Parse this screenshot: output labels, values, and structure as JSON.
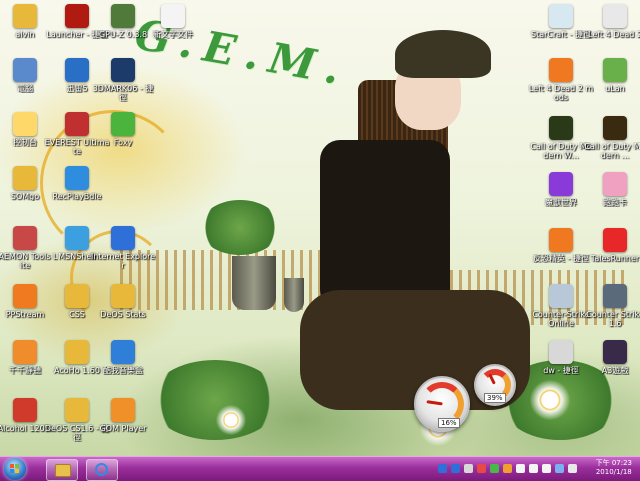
{
  "wallpaper": {
    "title_text": "G.E.M."
  },
  "desktop_icons_left": [
    {
      "name": "alvin",
      "icon": "folder-icon",
      "color": "#e8b83a"
    },
    {
      "name": "Launcher - 捷徑",
      "icon": "launcher-icon",
      "color": "#b01a10"
    },
    {
      "name": "GPU-Z 0.3.8",
      "icon": "gpuz-icon",
      "color": "#4f7a3a"
    },
    {
      "name": "新文字文件",
      "icon": "text-file-icon",
      "color": "#f4f4f4"
    },
    {
      "name": "電腦",
      "icon": "computer-icon",
      "color": "#5a8acb"
    },
    {
      "name": "迅雷5",
      "icon": "thunder-icon",
      "color": "#2a6fc6"
    },
    {
      "name": "3DMARK06 - 捷徑",
      "icon": "3dmark-icon",
      "color": "#1c3a6a"
    },
    {
      "name": "控制台",
      "icon": "control-panel-icon",
      "color": "#ffd86a"
    },
    {
      "name": "EVEREST Ultimate",
      "icon": "everest-icon",
      "color": "#c03030"
    },
    {
      "name": "Foxy",
      "icon": "foxy-icon",
      "color": "#4bb43c"
    },
    {
      "name": "SOMgo",
      "icon": "folder-icon",
      "color": "#e8b83a"
    },
    {
      "name": "RecPlayBdle",
      "icon": "recplay-icon",
      "color": "#2f8de0"
    },
    {
      "name": "DAEMON Tools Lite",
      "icon": "daemon-tools-icon",
      "color": "#c84848"
    },
    {
      "name": "MSNShell",
      "icon": "msnshell-icon",
      "color": "#3ca0e0"
    },
    {
      "name": "Internet Explorer",
      "icon": "ie-icon",
      "color": "#2f6fd8"
    },
    {
      "name": "PPStream",
      "icon": "ppstream-icon",
      "color": "#f07a20"
    },
    {
      "name": "CSS",
      "icon": "folder-icon",
      "color": "#e8b83a"
    },
    {
      "name": "DeOS Stats",
      "icon": "folder-icon",
      "color": "#e8b83a"
    },
    {
      "name": "千千靜聽",
      "icon": "ttplayer-icon",
      "color": "#f08c2c"
    },
    {
      "name": "AcoHo 1.60",
      "icon": "folder-icon",
      "color": "#e8b83a"
    },
    {
      "name": "酷我音樂盒",
      "icon": "kuwo-icon",
      "color": "#2f7fd8"
    },
    {
      "name": "Alcohol 120%",
      "icon": "alcohol-icon",
      "color": "#d03a2a"
    },
    {
      "name": "DeOS CS1.6 - 捷徑",
      "icon": "folder-icon",
      "color": "#e8b83a"
    },
    {
      "name": "GOM Player",
      "icon": "gom-player-icon",
      "color": "#f09028"
    }
  ],
  "desktop_icons_right": [
    {
      "name": "StarCraft - 捷徑",
      "icon": "starcraft-icon",
      "color": "#d8e8f0"
    },
    {
      "name": "Left 4 Dead 2",
      "icon": "l4d2-icon",
      "color": "#e8e8e8"
    },
    {
      "name": "Left 4 Dead 2 mods",
      "icon": "l4d-mods-icon",
      "color": "#f07820"
    },
    {
      "name": "uLan",
      "icon": "ulan-icon",
      "color": "#6ab04a"
    },
    {
      "name": "Call of Duty Modern W...",
      "icon": "cod-mw2-icon",
      "color": "#2a3a18"
    },
    {
      "name": "Call of Duty Modern ...",
      "icon": "cod-mw-icon",
      "color": "#3a2a10"
    },
    {
      "name": "魔獸世界",
      "icon": "warcraft-icon",
      "color": "#8a3ad8"
    },
    {
      "name": "跑跑卡",
      "icon": "kart-icon",
      "color": "#f0a0c0"
    },
    {
      "name": "反恐精英 - 捷徑",
      "icon": "half-life-icon",
      "color": "#f07820"
    },
    {
      "name": "TalesRunner",
      "icon": "talesrunner-icon",
      "color": "#e82828"
    },
    {
      "name": "Counter-Strike Online",
      "icon": "cso-icon",
      "color": "#b8c8d8"
    },
    {
      "name": "Counter Strike 1.6",
      "icon": "cs-icon",
      "color": "#5a6a7a"
    },
    {
      "name": "dw - 捷徑",
      "icon": "dw-icon",
      "color": "#d8d8d8"
    },
    {
      "name": "A3遊戲",
      "icon": "a3-icon",
      "color": "#3a2a4a"
    }
  ],
  "gadgets": {
    "cpu_percent": 16,
    "cpu_label": "16%",
    "memory_percent": 39,
    "memory_label": "39%"
  },
  "taskbar": {
    "pinned": [
      {
        "name": "windows-explorer-icon"
      },
      {
        "name": "internet-explorer-icon"
      }
    ],
    "tray_icons": [
      {
        "name": "language-icon",
        "color": "#2f6fd8"
      },
      {
        "name": "help-icon",
        "color": "#2f6fd8"
      },
      {
        "name": "app-tray-icon-1",
        "color": "#d8d8d8"
      },
      {
        "name": "app-tray-icon-2",
        "color": "#e84848"
      },
      {
        "name": "app-tray-icon-3",
        "color": "#48b848"
      },
      {
        "name": "app-tray-icon-4",
        "color": "#f0a030"
      },
      {
        "name": "flag-icon",
        "color": "#f4f4f4"
      },
      {
        "name": "volume-icon",
        "color": "#f4f4f4"
      },
      {
        "name": "network-icon",
        "color": "#f4f4f4"
      },
      {
        "name": "app-tray-icon-5",
        "color": "#7ab0f0"
      },
      {
        "name": "app-tray-icon-6",
        "color": "#e8e8e8"
      }
    ],
    "clock_time": "下午 07:23",
    "clock_date": "2010/1/18"
  }
}
